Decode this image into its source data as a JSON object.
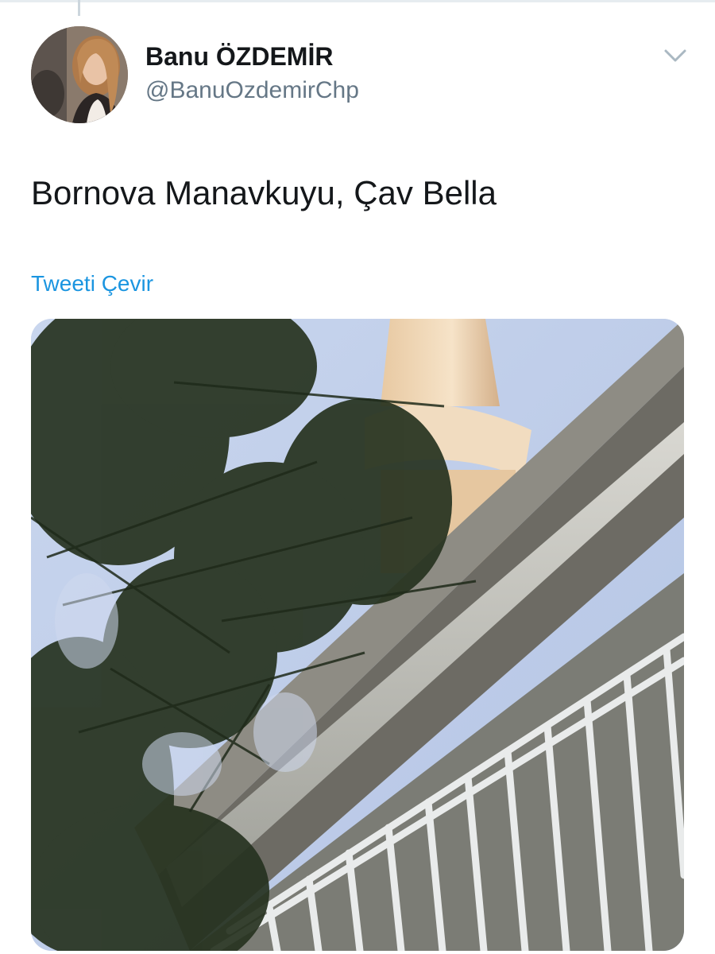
{
  "tweet": {
    "author_name": "Banu ÖZDEMİR",
    "author_handle": "@BanuOzdemirChp",
    "text": "Bornova Manavkuyu, Çav Bella",
    "translate_label": "Tweeti Çevir"
  },
  "icons": {
    "menu": "chevron-down-icon"
  },
  "colors": {
    "link": "#1b95e0",
    "secondary_text": "#657786",
    "primary_text": "#14171a"
  }
}
